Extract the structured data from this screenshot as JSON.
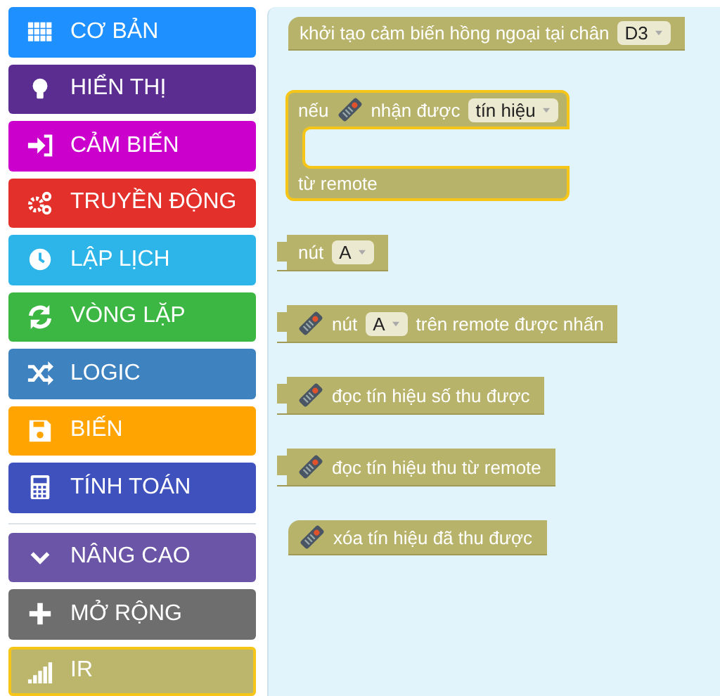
{
  "toolbox": {
    "categories": [
      {
        "label": "CƠ BẢN",
        "kind": "grid",
        "color": "#1e90ff",
        "selected": false
      },
      {
        "label": "HIỂN THỊ",
        "kind": "bulb",
        "color": "#5c2d91",
        "selected": false
      },
      {
        "label": "CẢM BIẾN",
        "kind": "sign-in",
        "color": "#cc00cc",
        "selected": false
      },
      {
        "label": "TRUYỀN ĐỘNG",
        "kind": "gears",
        "color": "#e3302a",
        "selected": false
      },
      {
        "label": "LẬP LỊCH",
        "kind": "clock",
        "color": "#2db4e8",
        "selected": false
      },
      {
        "label": "VÒNG LẶP",
        "kind": "refresh",
        "color": "#3db743",
        "selected": false
      },
      {
        "label": "LOGIC",
        "kind": "shuffle",
        "color": "#3f82c0",
        "selected": false
      },
      {
        "label": "BIẾN",
        "kind": "floppy",
        "color": "#ffa400",
        "selected": false
      },
      {
        "label": "TÍNH TOÁN",
        "kind": "calculator",
        "color": "#3f51bd",
        "selected": false
      }
    ],
    "more": [
      {
        "label": "NÂNG CAO",
        "kind": "chevron",
        "color": "#6a55a6",
        "selected": false
      },
      {
        "label": "MỞ RỘNG",
        "kind": "plus",
        "color": "#6e6e6e",
        "selected": false
      },
      {
        "label": "IR",
        "kind": "signal",
        "color": "#bcb66c",
        "selected": true
      }
    ]
  },
  "blocks": [
    {
      "kind": "statement",
      "selected": false,
      "rows": [
        [
          {
            "kind": "text",
            "text": "khởi tạo cảm biến hồng ngoại tại chân"
          },
          {
            "kind": "dropdown",
            "value": "D3"
          }
        ]
      ]
    },
    {
      "kind": "event",
      "selected": true,
      "rows": [
        [
          {
            "kind": "text",
            "text": "nếu"
          },
          {
            "kind": "remote"
          },
          {
            "kind": "text",
            "text": "nhận được"
          },
          {
            "kind": "dropdown",
            "value": "tín hiệu"
          }
        ],
        [
          {
            "kind": "text",
            "text": "từ remote"
          }
        ]
      ]
    },
    {
      "kind": "value",
      "selected": false,
      "rows": [
        [
          {
            "kind": "text",
            "text": "nút"
          },
          {
            "kind": "dropdown",
            "value": "A"
          }
        ]
      ]
    },
    {
      "kind": "value",
      "selected": false,
      "rows": [
        [
          {
            "kind": "remote"
          },
          {
            "kind": "text",
            "text": "nút"
          },
          {
            "kind": "dropdown",
            "value": "A"
          },
          {
            "kind": "text",
            "text": "trên remote được nhấn"
          }
        ]
      ]
    },
    {
      "kind": "value",
      "selected": false,
      "rows": [
        [
          {
            "kind": "remote"
          },
          {
            "kind": "text",
            "text": "đọc tín hiệu số thu được"
          }
        ]
      ]
    },
    {
      "kind": "value",
      "selected": false,
      "rows": [
        [
          {
            "kind": "remote"
          },
          {
            "kind": "text",
            "text": "đọc tín hiệu thu từ remote"
          }
        ]
      ]
    },
    {
      "kind": "statement",
      "selected": false,
      "rows": [
        [
          {
            "kind": "remote"
          },
          {
            "kind": "text",
            "text": "xóa tín hiệu đã thu được"
          }
        ]
      ]
    }
  ]
}
